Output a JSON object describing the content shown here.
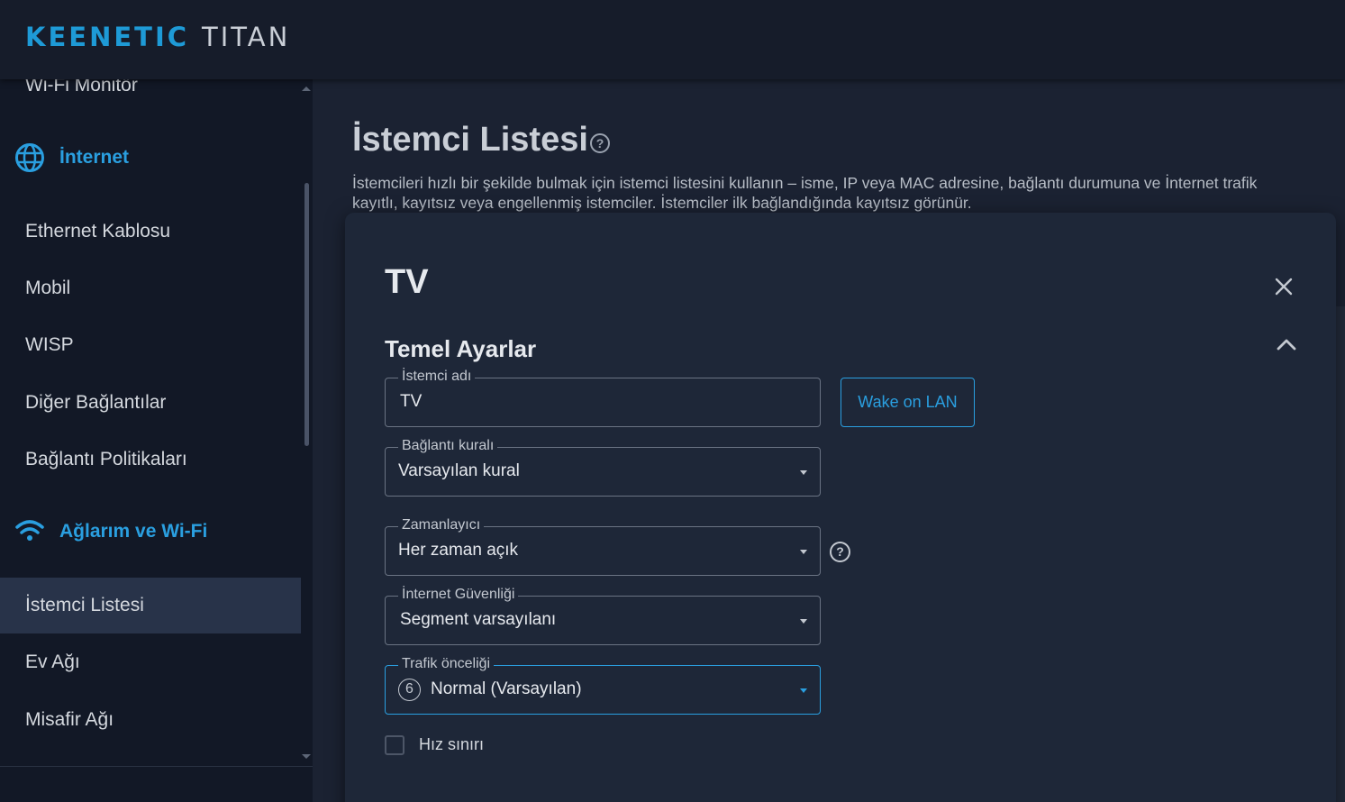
{
  "header": {
    "brand_primary": "KEENETIC",
    "brand_secondary": "TITAN"
  },
  "sidebar": {
    "top_item": "Wi-Fi Monitör",
    "sections": [
      {
        "label": "İnternet",
        "icon": "globe-icon"
      },
      {
        "label": "Ağlarım ve Wi-Fi",
        "icon": "wifi-icon"
      }
    ],
    "internet_items": [
      {
        "label": "Ethernet Kablosu"
      },
      {
        "label": "Mobil"
      },
      {
        "label": "WISP"
      },
      {
        "label": "Diğer Bağlantılar"
      },
      {
        "label": "Bağlantı Politikaları"
      }
    ],
    "network_items": [
      {
        "label": "İstemci Listesi",
        "active": true
      },
      {
        "label": "Ev Ağı"
      },
      {
        "label": "Misafir Ağı"
      }
    ]
  },
  "page": {
    "title": "İstemci Listesi",
    "description_line1": "İstemcileri hızlı bir şekilde bulmak için istemci listesini kullanın – isme, IP veya MAC adresine, bağlantı durumuna ve İnternet trafik",
    "description_line2": "kayıtlı, kayıtsız veya engellenmiş istemciler. İstemciler ilk bağlandığında kayıtsız görünür."
  },
  "modal": {
    "title": "TV",
    "section_title": "Temel Ayarlar",
    "client_name": {
      "label": "İstemci adı",
      "value": "TV"
    },
    "wake_on_lan": "Wake on LAN",
    "connection_rule": {
      "label": "Bağlantı kuralı",
      "value": "Varsayılan kural"
    },
    "scheduler": {
      "label": "Zamanlayıcı",
      "value": "Her zaman açık"
    },
    "internet_security": {
      "label": "İnternet Güvenliği",
      "value": "Segment varsayılanı"
    },
    "traffic_priority": {
      "label": "Trafik önceliği",
      "badge": "6",
      "value": "Normal (Varsayılan)"
    },
    "speed_limit": {
      "label": "Hız sınırı",
      "checked": false
    }
  },
  "colors": {
    "accent": "#2a9fe0",
    "background": "#1b2232",
    "sidebar": "#121826",
    "modal": "#1e2738"
  }
}
